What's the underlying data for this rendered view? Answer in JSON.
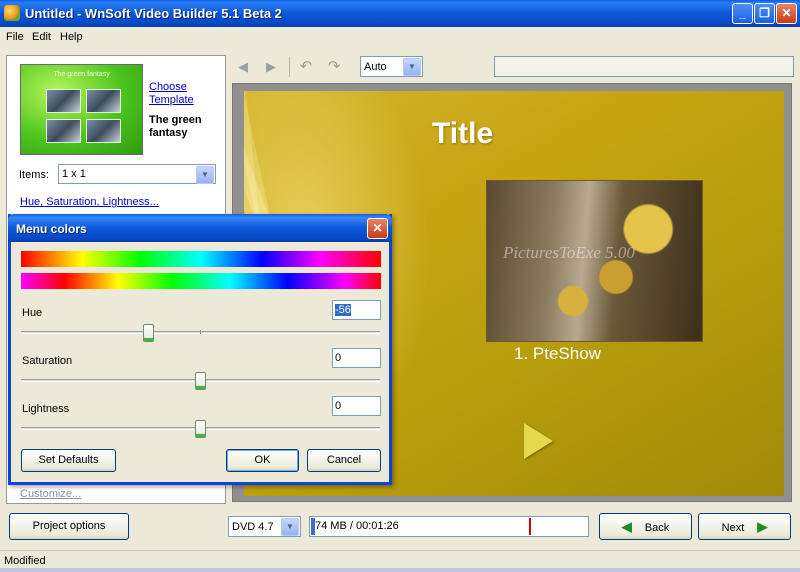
{
  "window": {
    "title": "Untitled - WnSoft Video Builder 5.1 Beta 2",
    "minimize_glyph": "_",
    "restore_glyph": "❐",
    "close_glyph": "✕"
  },
  "menu": {
    "items": [
      "File",
      "Edit",
      "Help"
    ]
  },
  "left_panel": {
    "template_thumb_title": "The green fantasy",
    "choose_template": "Choose Template",
    "template_name": "The green fantasy",
    "items_label": "Items:",
    "items_value": "1 x 1",
    "hsl_link": "Hue, Saturation, Lightness...",
    "customize_link": "Customize..."
  },
  "toolbar": {
    "icons": [
      "prev-icon",
      "next-icon",
      "undo-icon",
      "redo-icon"
    ],
    "prev_glyph": "◀",
    "next_glyph": "▶",
    "undo_glyph": "↶",
    "redo_glyph": "↷",
    "auto_value": "Auto"
  },
  "preview": {
    "title": "Title",
    "watermark": "PicturesToExe 5.00",
    "caption": "1. PteShow"
  },
  "bottom": {
    "project_options": "Project options",
    "disc_value": "DVD 4.7",
    "progress_text": "74 MB / 00:01:26",
    "progress_fraction": 0.016,
    "limit_fraction": 0.795,
    "back_label": "Back",
    "next_label": "Next",
    "back_glyph": "◀",
    "next_glyph": "▶"
  },
  "status": {
    "text": "Modified"
  },
  "dialog": {
    "title": "Menu colors",
    "close_glyph": "✕",
    "hue_label": "Hue",
    "hue_value": "-56",
    "hue_slider_fraction": 0.35,
    "saturation_label": "Saturation",
    "saturation_value": "0",
    "saturation_slider_fraction": 0.5,
    "lightness_label": "Lightness",
    "lightness_value": "0",
    "lightness_slider_fraction": 0.5,
    "set_defaults": "Set Defaults",
    "ok": "OK",
    "cancel": "Cancel"
  },
  "colors": {
    "title_bar": "#0a5ee8",
    "preview_background": "#c9a515",
    "progress_fill": "#3a6ed0",
    "limit_marker": "#cc0000"
  }
}
